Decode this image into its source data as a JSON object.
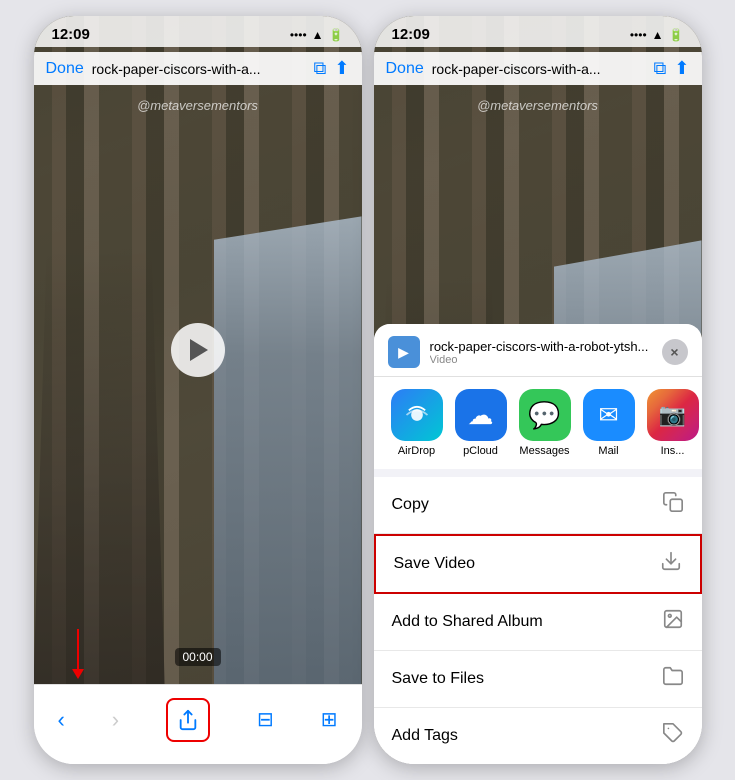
{
  "left_phone": {
    "status_time": "12:09",
    "address_bar": {
      "done": "Done",
      "url": "rock-paper-ciscors-with-a..."
    },
    "video": {
      "watermark": "@metaversementors",
      "timestamp": "00:00"
    },
    "bottom": {
      "share_label": "Share"
    }
  },
  "right_phone": {
    "status_time": "12:09",
    "address_bar": {
      "done": "Done",
      "url": "rock-paper-ciscors-with-a..."
    },
    "video": {
      "watermark": "@metaversementors"
    },
    "share_sheet": {
      "title": "rock-paper-ciscors-with-a-robot-ytsh...",
      "subtitle": "Video",
      "close": "×",
      "apps": [
        {
          "label": "AirDrop",
          "type": "airdrop"
        },
        {
          "label": "pCloud",
          "type": "pcloud"
        },
        {
          "label": "Messages",
          "type": "messages"
        },
        {
          "label": "Mail",
          "type": "mail"
        },
        {
          "label": "Ins...",
          "type": "instagram"
        }
      ],
      "actions": [
        {
          "label": "Copy",
          "icon": "copy",
          "highlighted": false
        },
        {
          "label": "Save Video",
          "icon": "save",
          "highlighted": true
        },
        {
          "label": "Add to Shared Album",
          "icon": "album",
          "highlighted": false
        },
        {
          "label": "Save to Files",
          "icon": "files",
          "highlighted": false
        },
        {
          "label": "Add Tags",
          "icon": "tags",
          "highlighted": false
        }
      ]
    }
  }
}
